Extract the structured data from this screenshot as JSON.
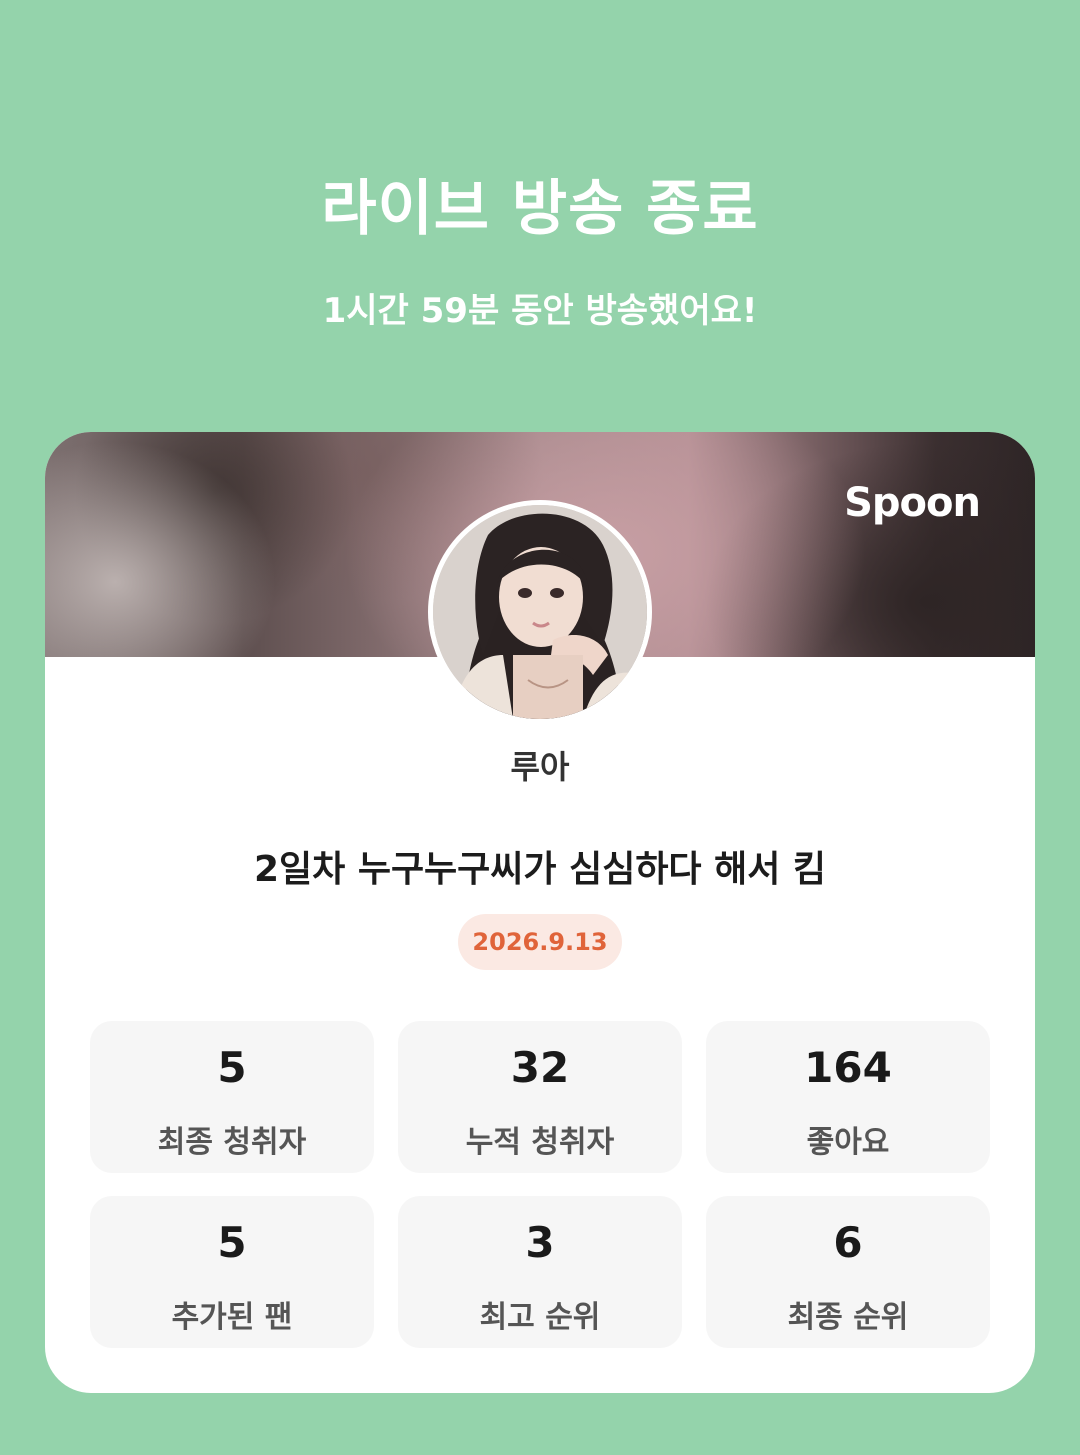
{
  "header": {
    "title": "라이브 방송 종료",
    "subtitle": "1시간 59분 동안 방송했어요!"
  },
  "card": {
    "brand": "Spoon",
    "nickname": "루아",
    "live_title": "2일차 누구누구씨가 심심하다 해서 킴",
    "date": "2026.9.13",
    "stats": [
      {
        "value": "5",
        "label": "최종 청취자"
      },
      {
        "value": "32",
        "label": "누적 청취자"
      },
      {
        "value": "164",
        "label": "좋아요"
      },
      {
        "value": "5",
        "label": "추가된 팬"
      },
      {
        "value": "3",
        "label": "최고 순위"
      },
      {
        "value": "6",
        "label": "최종 순위"
      }
    ]
  },
  "colors": {
    "background": "#94d3ab",
    "date_text": "#e0643a",
    "date_badge": "#fbe9e3"
  }
}
